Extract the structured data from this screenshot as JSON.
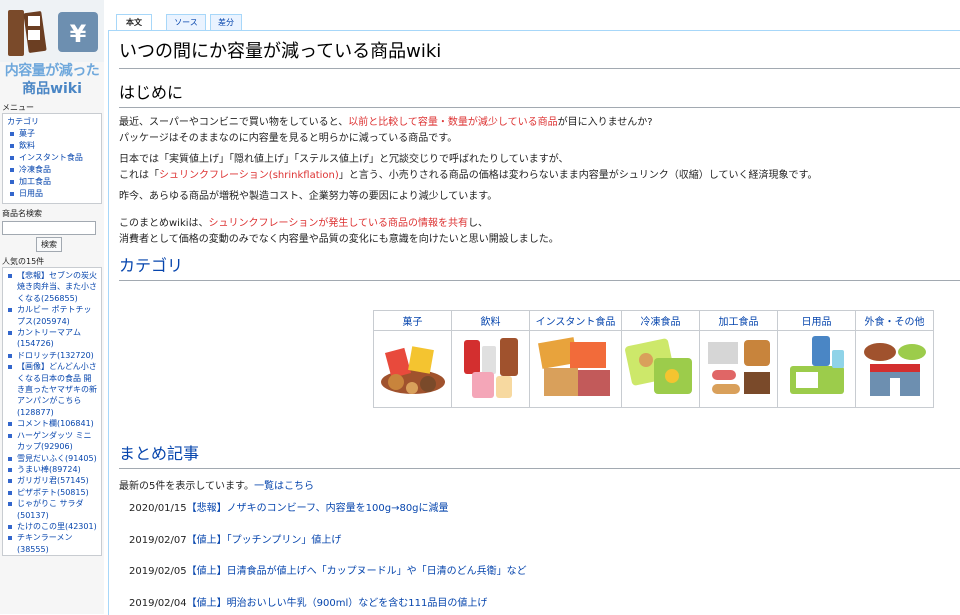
{
  "sidebar": {
    "logo_line1": "内容量が減った",
    "logo_line2": "商品wiki",
    "menu_heading": "メニュー",
    "category_title": "カテゴリ",
    "category_items": [
      "菓子",
      "飲料",
      "インスタント食品",
      "冷凍食品",
      "加工食品",
      "日用品"
    ],
    "search_heading": "商品名検索",
    "search_value": "",
    "search_button": "検索",
    "popular_heading": "人気の15件",
    "popular_items": [
      "【悲報】セブンの炭火焼き肉弁当、また小さくなる(256855)",
      "カルビー ポテトチップス(205974)",
      "カントリーマアム(154726)",
      "ドロリッチ(132720)",
      "【画像】どんどん小さくなる日本の食品 開き直ったヤマザキの新アンパンがこちら(128877)",
      "コメント欄(106841)",
      "ハーゲンダッツ ミニカップ(92906)",
      "雪見だいふく(91405)",
      "うまい棒(89724)",
      "ガリガリ君(57145)",
      "ピザポテト(50815)",
      "じゃがりこ サラダ(50137)",
      "たけのこの里(42301)",
      "チキンラーメン(38555)"
    ]
  },
  "tabs": {
    "main": "本文",
    "source": "ソース",
    "diff": "差分"
  },
  "page": {
    "title": "いつの間にか容量が減っている商品wiki",
    "intro_heading": "はじめに",
    "p1a_1": "最近、スーパーやコンビニで買い物をしていると、",
    "p1a_red": "以前と比較して容量・数量が減少している商品",
    "p1a_2": "が目に入りませんか?",
    "p1b": "パッケージはそのままなのに内容量を見ると明らかに減っている商品です。",
    "p2a": "日本では「実質値上げ」「隠れ値上げ」「ステルス値上げ」と冗談交じりで呼ばれたりしていますが、",
    "p2b_1": "これは「",
    "p2b_red": "シュリンクフレーション(shrinkflation)",
    "p2b_2": "」と言う、小売りされる商品の価格は変わらないまま内容量がシュリンク（収縮）していく経済現象です。",
    "p3": "昨今、あらゆる商品が増税や製造コスト、企業努力等の要因により減少しています。",
    "p4a_1": "このまとめwikiは、",
    "p4a_red": "シュリンクフレーションが発生している商品の情報を共有",
    "p4a_2": "し、",
    "p4b": "消費者として価格の変動のみでなく内容量や品質の変化にも意識を向けたいと思い開設しました。",
    "category_heading": "カテゴリ",
    "categories": [
      "菓子",
      "飲料",
      "インスタント食品",
      "冷凍食品",
      "加工食品",
      "日用品",
      "外食・その他"
    ],
    "summary_heading": "まとめ記事",
    "summary_intro": "最新の5件を表示しています。",
    "summary_list_link": "一覧はこちら",
    "articles": [
      {
        "date": "2020/01/15",
        "title": "【悲報】ノザキのコンビーフ、内容量を100g→80gに減量"
      },
      {
        "date": "2019/02/07",
        "title": "【値上】「プッチンプリン」値上げ"
      },
      {
        "date": "2019/02/05",
        "title": "【値上】日清食品が値上げへ「カップヌードル」や「日清のどん兵衛」など"
      },
      {
        "date": "2019/02/04",
        "title": "【値上】明治おいしい牛乳（900ml）などを含む111品目の値上げ"
      }
    ]
  },
  "colors": {
    "link": "#0645ad",
    "highlight": "#d33333",
    "border": "#a7d7f9"
  }
}
